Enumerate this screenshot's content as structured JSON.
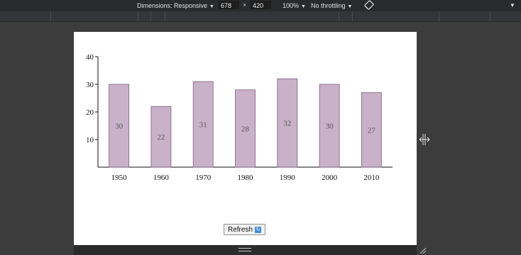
{
  "toolbar": {
    "dimensions_label": "Dimensions: Responsive",
    "width_value": "678",
    "times": "×",
    "height_value": "420",
    "zoom": "100%",
    "throttling": "No throttling"
  },
  "chart_data": {
    "type": "bar",
    "categories": [
      "1950",
      "1960",
      "1970",
      "1980",
      "1990",
      "2000",
      "2010"
    ],
    "values": [
      30,
      22,
      31,
      28,
      32,
      30,
      27
    ],
    "y_ticks": [
      "10",
      "20",
      "30",
      "40"
    ],
    "ylim": [
      0,
      40
    ],
    "grid": false,
    "bar_color": "#c9b1c9",
    "bar_stroke": "#7d5e7d"
  },
  "refresh_label": "Refresh",
  "refresh_icon": "refresh-icon"
}
